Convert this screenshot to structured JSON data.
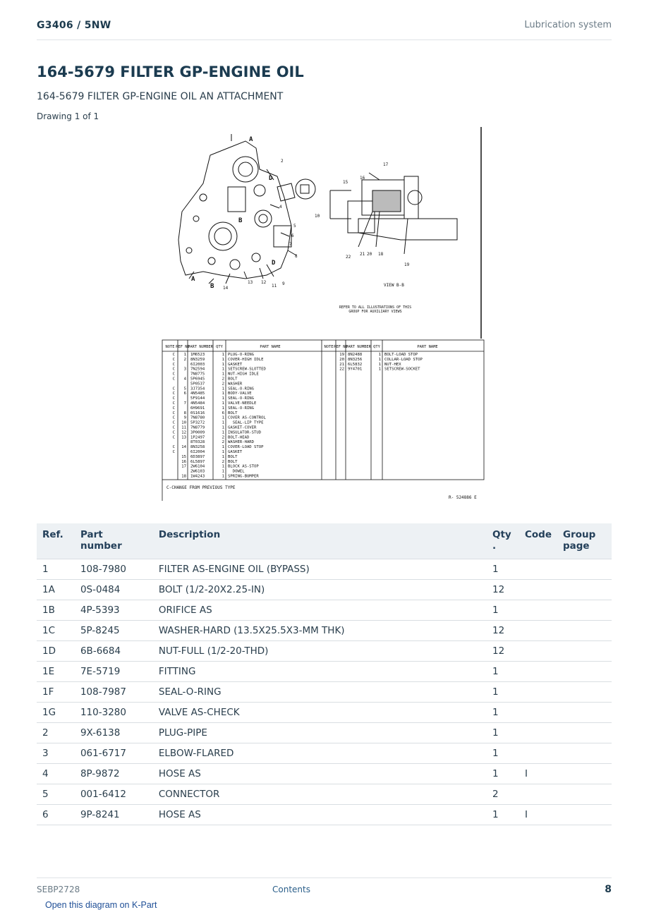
{
  "header": {
    "doc_id": "G3406  /  5NW",
    "section": "Lubrication system"
  },
  "title": "164-5679 FILTER GP-ENGINE OIL",
  "subtitle": "164-5679 FILTER GP-ENGINE OIL AN ATTACHMENT",
  "drawing_label": "Drawing 1 of 1",
  "diagram": {
    "view_label": "VIEW B-B",
    "note": "REFER TO ALL ILLUSTRATIONS OF THIS GROUP FOR AUXILIARY VIEWS",
    "change_note": "C-CHANGE FROM PREVIOUS TYPE",
    "ref_code": "R- 524886 E",
    "col_headers": [
      "NOTE",
      "REF NO",
      "PART NUMBER",
      "QTY",
      "PART NAME"
    ],
    "left_rows": [
      [
        "C",
        "1",
        "1M6523",
        "1",
        "PLUG-O-RING"
      ],
      [
        "C",
        "2",
        "8N3259",
        "1",
        "COVER-HIGH IDLE"
      ],
      [
        "C",
        "",
        "6I2003",
        "1",
        "GASKET"
      ],
      [
        "C",
        "3",
        "7N2594",
        "1",
        "SETSCREW-SLOTTED"
      ],
      [
        "C",
        "",
        "7N8775",
        "1",
        "NUT-HIGH IDLE"
      ],
      [
        "C",
        "4",
        "5P6945",
        "2",
        "BOLT"
      ],
      [
        "",
        "",
        "5P0537",
        "2",
        "WASHER"
      ],
      [
        "C",
        "5",
        "3J7354",
        "1",
        "SEAL-O-RING"
      ],
      [
        "C",
        "6",
        "4N5485",
        "1",
        "BODY-VALVE"
      ],
      [
        "C",
        "",
        "5F9144",
        "1",
        "SEAL-O-RING"
      ],
      [
        "C",
        "7",
        "4N5484",
        "1",
        "VALVE-NEEDLE"
      ],
      [
        "C",
        "",
        "6H9691",
        "1",
        "SEAL-O-RING"
      ],
      [
        "C",
        "8",
        "0S1616",
        "6",
        "BOLT"
      ],
      [
        "C",
        "9",
        "7N8780",
        "1",
        "COVER AS-CONTROL"
      ],
      [
        "C",
        "10",
        "5P3272",
        "1",
        "  SEAL-LIP TYPE"
      ],
      [
        "C",
        "11",
        "7N8779",
        "1",
        "GASKET-COVER"
      ],
      [
        "C",
        "12",
        "3P0009",
        "1",
        "INSULATOR-STUD"
      ],
      [
        "C",
        "13",
        "1P2497",
        "2",
        "BOLT-HEAD"
      ],
      [
        "",
        "",
        "8T0328",
        "2",
        "WASHER-HARD"
      ],
      [
        "C",
        "14",
        "8N3258",
        "1",
        "COVER-LOAD STOP"
      ],
      [
        "C",
        "",
        "6I2004",
        "1",
        "GASKET"
      ],
      [
        "",
        "15",
        "6D3897",
        "1",
        "BOLT"
      ],
      [
        "",
        "16",
        "6L5897",
        "2",
        "BOLT"
      ],
      [
        "",
        "17",
        "2W6104",
        "1",
        "BLOCK AS-STOP"
      ],
      [
        "",
        "",
        "2W6103",
        "1",
        "  DOWEL"
      ],
      [
        "",
        "18",
        "1W4243",
        "1",
        "SPRING-BUMPER"
      ]
    ],
    "right_rows": [
      [
        "",
        "19",
        "8N2488",
        "1",
        "BOLT-LOAD STOP"
      ],
      [
        "",
        "20",
        "8N3256",
        "1",
        "COLLAR-LOAD STOP"
      ],
      [
        "",
        "21",
        "6L5832",
        "1",
        "NUT-HEX"
      ],
      [
        "",
        "22",
        "9Y4701",
        "1",
        "SETSCREW-SOCKET"
      ]
    ]
  },
  "table": {
    "headers": {
      "ref": "Ref.",
      "part_number": "Part number",
      "description": "Description",
      "qty": "Qty",
      "qty_dot": ".",
      "code": "Code",
      "group_page": "Group page"
    },
    "rows": [
      {
        "ref": "1",
        "part": "108-7980",
        "desc": "FILTER AS-ENGINE OIL (BYPASS)",
        "qty": "1",
        "code": "",
        "group": ""
      },
      {
        "ref": "1A",
        "part": "0S-0484",
        "desc": "BOLT (1/2-20X2.25-IN)",
        "qty": "12",
        "code": "",
        "group": ""
      },
      {
        "ref": "1B",
        "part": "4P-5393",
        "desc": "ORIFICE AS",
        "qty": "1",
        "code": "",
        "group": ""
      },
      {
        "ref": "1C",
        "part": "5P-8245",
        "desc": "WASHER-HARD (13.5X25.5X3-MM THK)",
        "qty": "12",
        "code": "",
        "group": ""
      },
      {
        "ref": "1D",
        "part": "6B-6684",
        "desc": "NUT-FULL (1/2-20-THD)",
        "qty": "12",
        "code": "",
        "group": ""
      },
      {
        "ref": "1E",
        "part": "7E-5719",
        "desc": "FITTING",
        "qty": "1",
        "code": "",
        "group": ""
      },
      {
        "ref": "1F",
        "part": "108-7987",
        "desc": "SEAL-O-RING",
        "qty": "1",
        "code": "",
        "group": ""
      },
      {
        "ref": "1G",
        "part": "110-3280",
        "desc": "VALVE AS-CHECK",
        "qty": "1",
        "code": "",
        "group": ""
      },
      {
        "ref": "2",
        "part": "9X-6138",
        "desc": "PLUG-PIPE",
        "qty": "1",
        "code": "",
        "group": ""
      },
      {
        "ref": "3",
        "part": "061-6717",
        "desc": "ELBOW-FLARED",
        "qty": "1",
        "code": "",
        "group": ""
      },
      {
        "ref": "4",
        "part": "8P-9872",
        "desc": "HOSE AS",
        "qty": "1",
        "code": "I",
        "group": ""
      },
      {
        "ref": "5",
        "part": "001-6412",
        "desc": "CONNECTOR",
        "qty": "2",
        "code": "",
        "group": ""
      },
      {
        "ref": "6",
        "part": "9P-8241",
        "desc": "HOSE AS",
        "qty": "1",
        "code": "I",
        "group": ""
      }
    ]
  },
  "footer": {
    "doc_code": "SEBP2728",
    "contents_link": "Contents",
    "page_number": "8"
  },
  "kpart_link": "Open this diagram on K-Part"
}
